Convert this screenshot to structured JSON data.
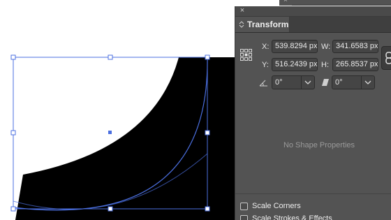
{
  "panel": {
    "close_glyph": "×",
    "tab_label": "Transform"
  },
  "top_strip": {
    "close_glyph": "×"
  },
  "transform": {
    "x_label": "X:",
    "x_value": "539.8294 px",
    "w_label": "W:",
    "w_value": "341.6583 px",
    "y_label": "Y:",
    "y_value": "516.2439 px",
    "h_label": "H:",
    "h_value": "265.8537 px",
    "rotate_value": "0°",
    "shear_value": "0°"
  },
  "shape_properties_text": "No Shape Properties",
  "options": {
    "scale_corners_label": "Scale Corners",
    "scale_strokes_label": "Scale Strokes & Effects"
  },
  "colors": {
    "panel_bg": "#535353",
    "tab_bg": "#3f3f3f",
    "selection_accent": "#4b6fe0"
  },
  "icons": {
    "close": "close-icon",
    "reference_point": "reference-point-icon",
    "rotate": "rotate-angle-icon",
    "shear": "shear-icon",
    "constrain": "link-icon",
    "dropdown": "chevron-down-icon"
  }
}
